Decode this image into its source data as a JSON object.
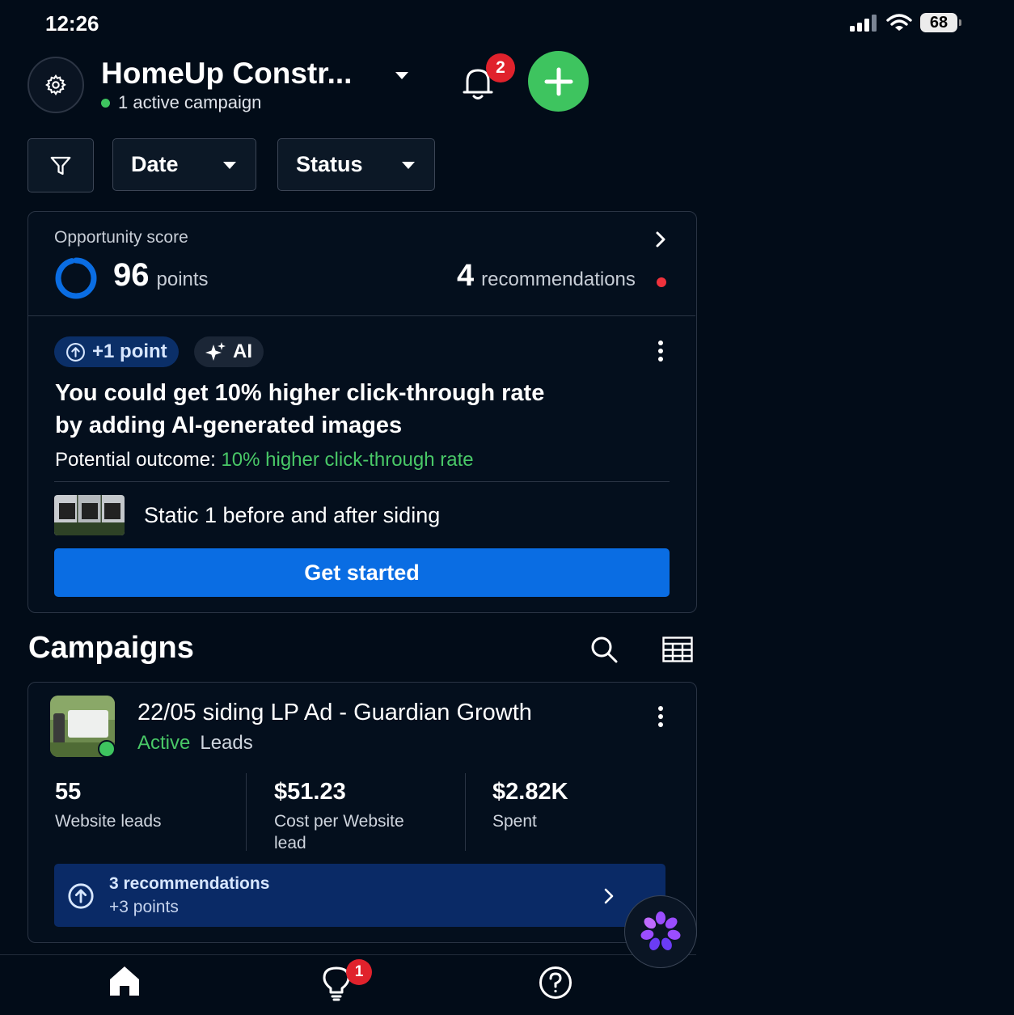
{
  "status_bar": {
    "time": "12:26",
    "battery": "68"
  },
  "header": {
    "account_name": "HomeUp Constr...",
    "active_campaigns": "1 active campaign",
    "notification_count": "2"
  },
  "filters": {
    "date_label": "Date",
    "status_label": "Status"
  },
  "opportunity": {
    "title": "Opportunity score",
    "score": "96",
    "score_unit": "points",
    "score_fraction": 0.96,
    "recommendations_count": "4",
    "recommendations_label": "recommendations"
  },
  "recommendation": {
    "points_tag": "+1 point",
    "ai_tag": "AI",
    "headline_line1": "You could get 10% higher click-through rate",
    "headline_line2": "by adding AI-generated images",
    "outcome_label": "Potential outcome: ",
    "outcome_value": "10% higher click-through rate",
    "asset_name": "Static 1 before and after siding",
    "cta_label": "Get started"
  },
  "campaigns": {
    "section_title": "Campaigns",
    "items": [
      {
        "name": "22/05 siding LP Ad - Guardian Growth",
        "status": "Active",
        "objective": "Leads",
        "metrics": [
          {
            "value": "55",
            "label": "Website leads"
          },
          {
            "value": "$51.23",
            "label": "Cost per Website lead"
          },
          {
            "value": "$2.82K",
            "label": "Spent"
          }
        ],
        "recommendations": {
          "title": "3 recommendations",
          "points": "+3 points"
        }
      }
    ]
  },
  "bottom_nav": {
    "ideas_badge": "1"
  },
  "colors": {
    "accent_green": "#3ec45f",
    "primary_blue": "#0a6de3",
    "badge_red": "#e0222c"
  }
}
